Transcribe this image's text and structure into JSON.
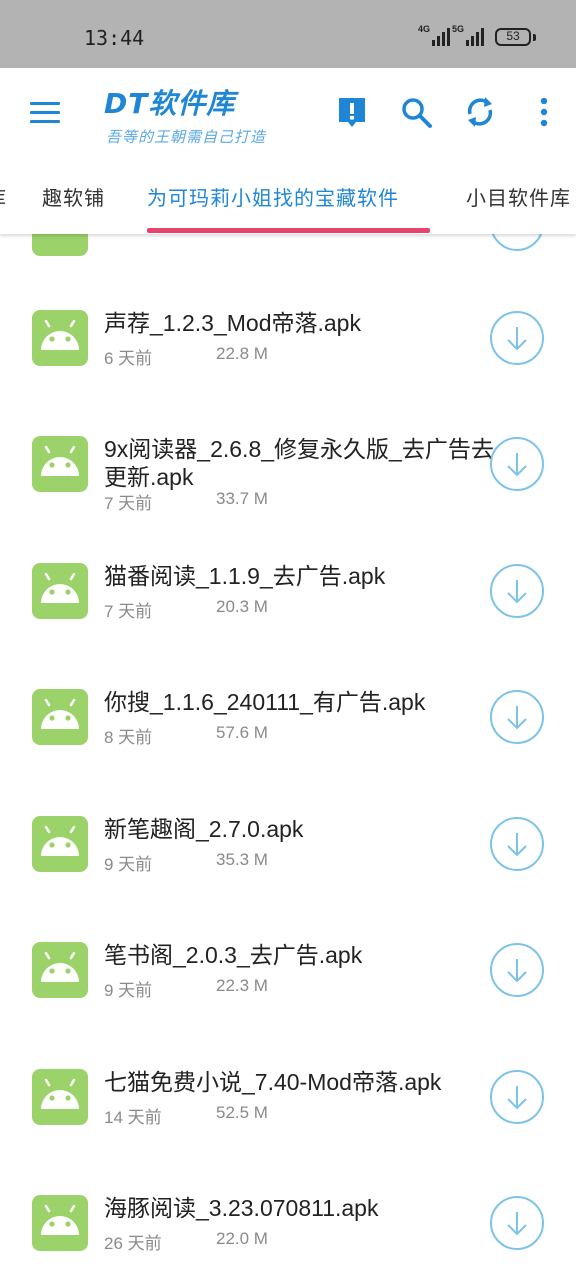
{
  "status": {
    "time": "13:44",
    "net1": "4G",
    "net2": "5G",
    "battery": "53"
  },
  "app": {
    "title": "DT软件库",
    "subtitle": "吾等的王朝需自己打造"
  },
  "toolbar": {
    "icons": [
      "menu-icon",
      "info-icon",
      "search-icon",
      "refresh-icon",
      "more-vert-icon"
    ],
    "accent": "#1f86d6"
  },
  "tabs": [
    {
      "label": "库"
    },
    {
      "label": "趣软铺"
    },
    {
      "label": "为可玛莉小姐找的宝藏软件",
      "active": true
    },
    {
      "label": "小目软件库"
    }
  ],
  "indicator_color": "#e8436c",
  "files": [
    {
      "name": "声荐_1.2.3_Mod帝落.apk",
      "date": "6 天前",
      "size": "22.8 M"
    },
    {
      "name": "9x阅读器_2.6.8_修复永久版_去广告去更新.apk",
      "date": "7 天前",
      "size": "33.7 M"
    },
    {
      "name": "猫番阅读_1.1.9_去广告.apk",
      "date": "7 天前",
      "size": "20.3 M"
    },
    {
      "name": "你搜_1.1.6_240111_有广告.apk",
      "date": "8 天前",
      "size": "57.6 M"
    },
    {
      "name": "新笔趣阁_2.7.0.apk",
      "date": "9 天前",
      "size": "35.3 M"
    },
    {
      "name": "笔书阁_2.0.3_去广告.apk",
      "date": "9 天前",
      "size": "22.3 M"
    },
    {
      "name": "七猫免费小说_7.40-Mod帝落.apk",
      "date": "14 天前",
      "size": "52.5 M"
    },
    {
      "name": "海豚阅读_3.23.070811.apk",
      "date": "26 天前",
      "size": "22.0 M"
    }
  ]
}
